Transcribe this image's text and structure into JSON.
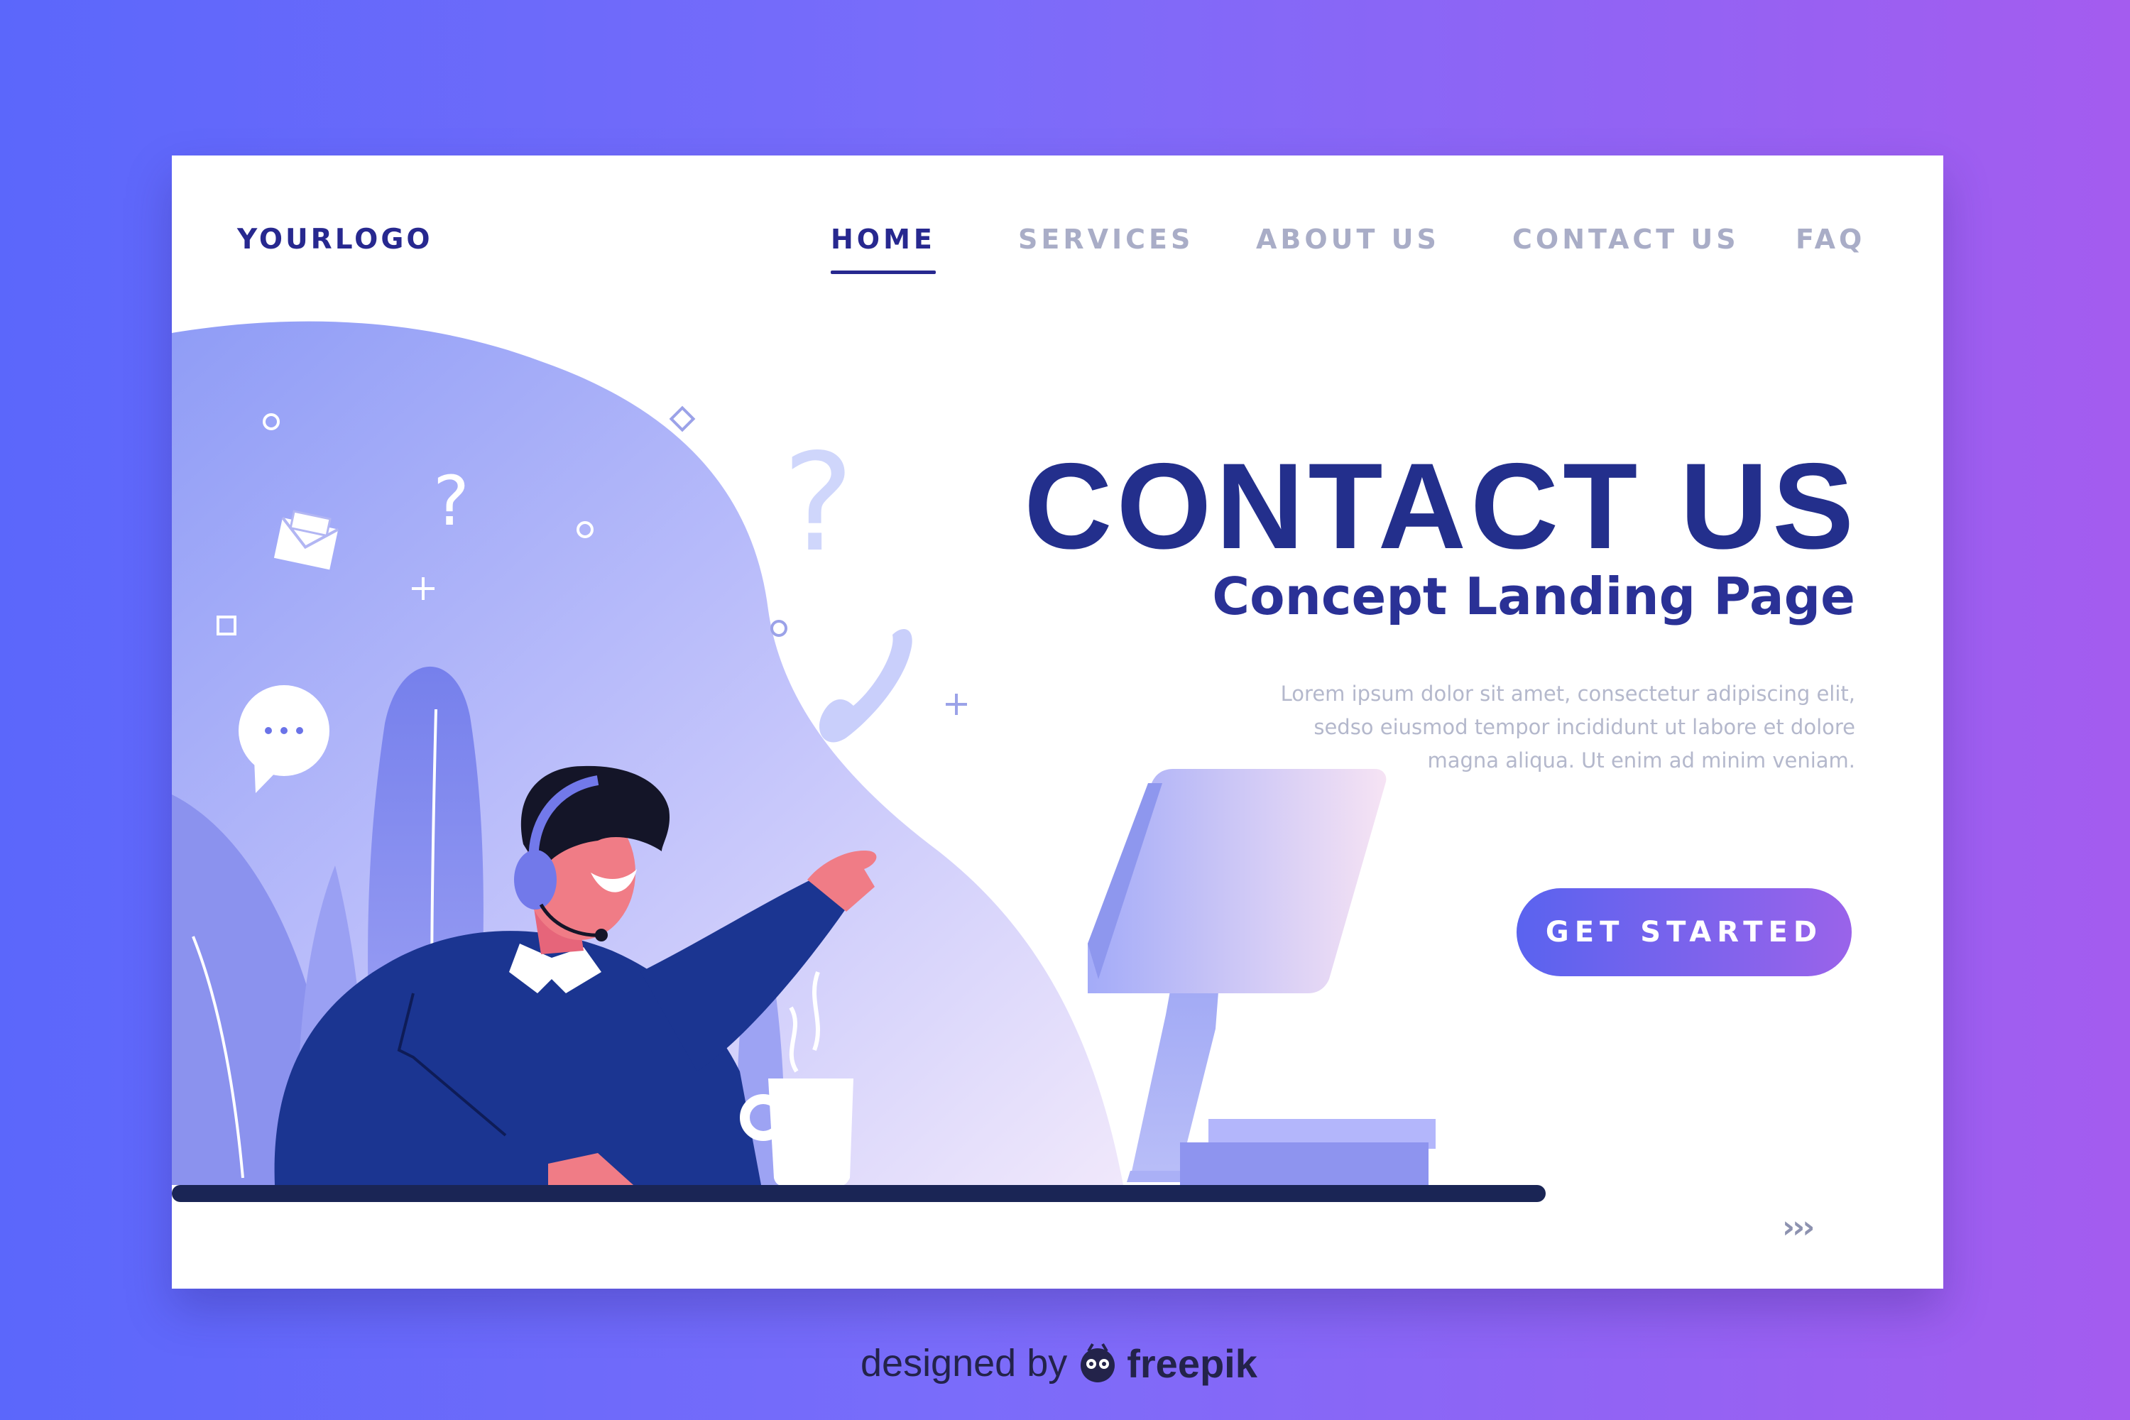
{
  "logo": {
    "text": "YOURLOGO"
  },
  "nav": {
    "items": [
      {
        "label": "HOME",
        "active": true
      },
      {
        "label": "SERVICES",
        "active": false
      },
      {
        "label": "ABOUT US",
        "active": false
      },
      {
        "label": "CONTACT US",
        "active": false
      },
      {
        "label": "FAQ",
        "active": false
      }
    ]
  },
  "hero": {
    "title": "CONTACT US",
    "subtitle": "Concept Landing Page",
    "body": "Lorem ipsum dolor sit amet, consectetur adipiscing elit, sedso eiusmod tempor incididunt ut labore et dolore magna aliqua. Ut enim ad minim veniam.",
    "cta_label": "GET STARTED"
  },
  "pagination": {
    "arrows": "›››"
  },
  "credit": {
    "prefix": "designed by",
    "brand": "freepik"
  },
  "colors": {
    "primary": "#27288f",
    "nav_inactive": "#a9adc7",
    "body_text": "#b4b8cc",
    "cta_start": "#5a63ef",
    "cta_end": "#9a63ea",
    "bg_start": "#5b67fb",
    "bg_end": "#a45cef"
  },
  "icons": [
    "question-mark-icon",
    "envelope-icon",
    "chat-bubble-icon",
    "phone-icon",
    "plus-sparkle-icon",
    "circle-sparkle-icon",
    "diamond-sparkle-icon"
  ]
}
